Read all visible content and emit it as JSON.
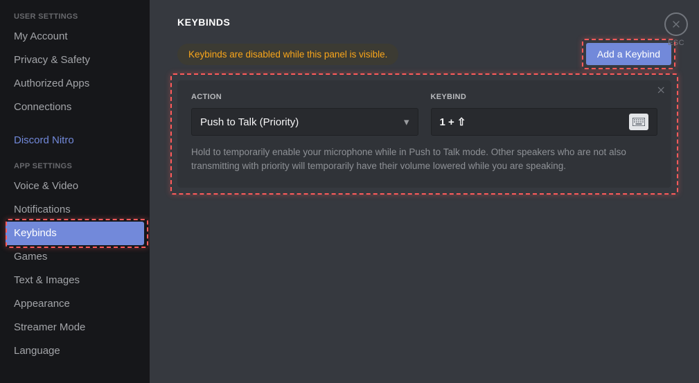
{
  "sidebar": {
    "header_user": "USER SETTINGS",
    "header_app": "APP SETTINGS",
    "user_items": [
      "My Account",
      "Privacy & Safety",
      "Authorized Apps",
      "Connections"
    ],
    "nitro_label": "Discord Nitro",
    "app_items": [
      "Voice & Video",
      "Notifications",
      "Keybinds",
      "Games",
      "Text & Images",
      "Appearance",
      "Streamer Mode",
      "Language"
    ],
    "selected": "Keybinds"
  },
  "page": {
    "title": "KEYBINDS",
    "warning": "Keybinds are disabled while this panel is visible.",
    "add_button": "Add a Keybind",
    "esc_label": "ESC"
  },
  "card": {
    "action_label": "ACTION",
    "keybind_label": "KEYBIND",
    "action_value": "Push to Talk (Priority)",
    "keybind_value": "1 + ⇧",
    "description": "Hold to temporarily enable your microphone while in Push to Talk mode. Other speakers who are not also transmitting with priority will temporarily have their volume lowered while you are speaking."
  },
  "colors": {
    "accent": "#7289da",
    "warning": "#faa61a",
    "highlight": "#ff5b5b"
  }
}
